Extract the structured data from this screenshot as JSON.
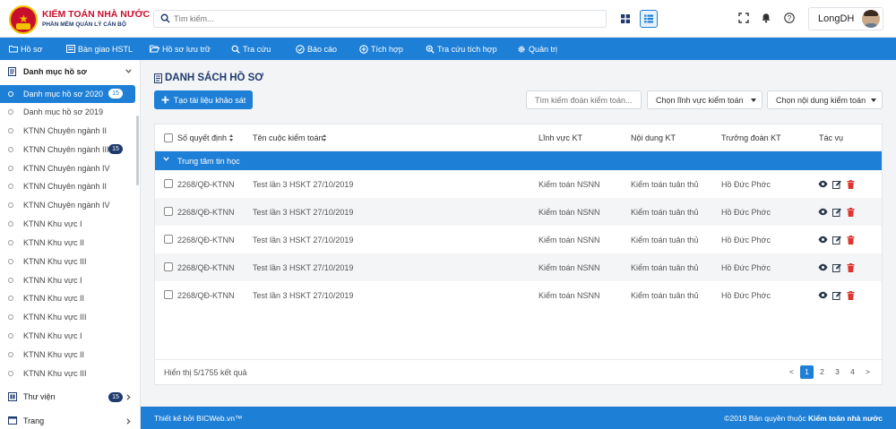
{
  "brand": {
    "title": "KIỂM TOÁN NHÀ NƯỚC",
    "subtitle": "PHẦN MỀM QUẢN LÝ CÁN BỘ"
  },
  "search": {
    "placeholder": "Tìm kiếm..."
  },
  "user": {
    "name": "LongDH"
  },
  "nav": [
    {
      "label": "Hồ sơ",
      "icon": "folder-icon"
    },
    {
      "label": "Bàn giao HSTL",
      "icon": "list-icon"
    },
    {
      "label": "Hồ sơ lưu trữ",
      "icon": "folder-open-icon"
    },
    {
      "label": "Tra cứu",
      "icon": "search-icon"
    },
    {
      "label": "Báo cáo",
      "icon": "check-circle-icon"
    },
    {
      "label": "Tích hợp",
      "icon": "plus-circle-icon"
    },
    {
      "label": "Tra cứu tích hợp",
      "icon": "search-plus-icon"
    },
    {
      "label": "Quản trị",
      "icon": "gear-icon"
    }
  ],
  "sidebar": {
    "header": "Danh mục hồ sơ",
    "items": [
      {
        "label": "Danh mục hồ sơ 2020",
        "badge": "15",
        "active": true
      },
      {
        "label": "Danh mục hồ sơ 2019"
      },
      {
        "label": "KTNN Chuyên ngành II"
      },
      {
        "label": "KTNN Chuyên ngành III",
        "badge": "15"
      },
      {
        "label": "KTNN Chuyên ngành IV"
      },
      {
        "label": "KTNN Chuyên ngành II"
      },
      {
        "label": "KTNN Chuyên ngành IV"
      },
      {
        "label": "KTNN Khu vực I"
      },
      {
        "label": "KTNN Khu vực II"
      },
      {
        "label": "KTNN Khu vực III"
      },
      {
        "label": "KTNN Khu vực I"
      },
      {
        "label": "KTNN Khu vực II"
      },
      {
        "label": "KTNN Khu vực III"
      },
      {
        "label": "KTNN Khu vực I"
      },
      {
        "label": "KTNN Khu vực II"
      },
      {
        "label": "KTNN Khu vực III"
      }
    ],
    "footer": [
      {
        "label": "Thư viện",
        "badge": "15"
      },
      {
        "label": "Trang"
      }
    ]
  },
  "main": {
    "title": "DANH SÁCH HỒ SƠ",
    "create_label": "Tạo tài liệu khảo sát",
    "filter_placeholder": "Tìm kiếm đoàn kiểm toán...",
    "select_field": "Chọn lĩnh vực kiểm toán",
    "select_content": "Chọn nội dung kiểm toán"
  },
  "table": {
    "columns": [
      "Số quyết định",
      "Tên cuộc kiểm toán",
      "Lĩnh vực KT",
      "Nội dung KT",
      "Trưởng đoàn KT",
      "Tác vụ"
    ],
    "group": "Trung tâm tin học",
    "rows": [
      [
        "2268/QĐ-KTNN",
        "Test lần 3 HSKT 27/10/2019",
        "Kiểm toán NSNN",
        "Kiểm toán tuân thủ",
        "Hồ Đức Phớc"
      ],
      [
        "2268/QĐ-KTNN",
        "Test lần 3 HSKT 27/10/2019",
        "Kiểm toán NSNN",
        "Kiểm toán tuân thủ",
        "Hồ Đức Phớc"
      ],
      [
        "2268/QĐ-KTNN",
        "Test lần 3 HSKT 27/10/2019",
        "Kiểm toán NSNN",
        "Kiểm toán tuân thủ",
        "Hồ Đức Phớc"
      ],
      [
        "2268/QĐ-KTNN",
        "Test lần 3 HSKT 27/10/2019",
        "Kiểm toán NSNN",
        "Kiểm toán tuân thủ",
        "Hồ Đức Phớc"
      ],
      [
        "2268/QĐ-KTNN",
        "Test lần 3 HSKT 27/10/2019",
        "Kiểm toán NSNN",
        "Kiểm toán tuân thủ",
        "Hồ Đức Phớc"
      ]
    ],
    "result_info": "Hiển thị 5/1755 kết quả",
    "pagination": {
      "prev": "<",
      "pages": [
        "1",
        "2",
        "3",
        "4"
      ],
      "current": "1",
      "next": ">"
    }
  },
  "footer": {
    "designed_by": "Thiết kế bởi BICWeb.vn™",
    "copyright_prefix": "©2019 Bản quyền thuộc",
    "copyright_owner": "Kiểm toán nhà nước"
  },
  "colors": {
    "primary": "#1e7fd6",
    "brand_red": "#c8102e",
    "navy": "#1e3a6e",
    "delete": "#e0342f"
  }
}
